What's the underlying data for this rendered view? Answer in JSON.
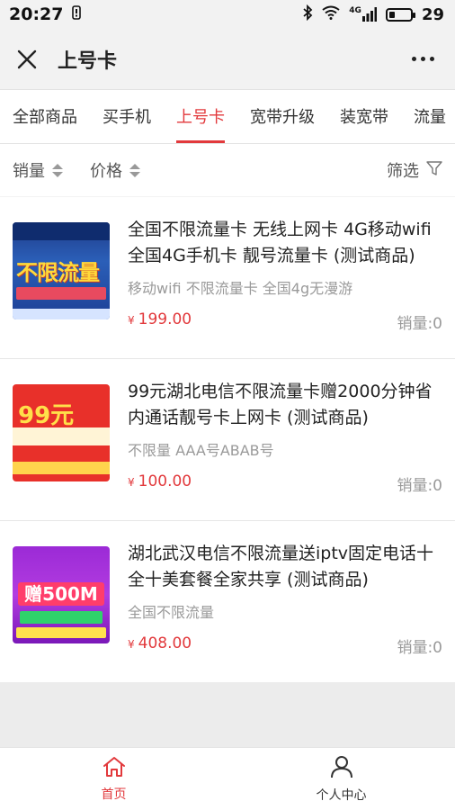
{
  "status": {
    "time": "20:27",
    "network": "4G",
    "battery": "29",
    "battery_level": 0.29
  },
  "titlebar": {
    "title": "上号卡"
  },
  "tabs": [
    {
      "label": "全部商品",
      "active": false
    },
    {
      "label": "买手机",
      "active": false
    },
    {
      "label": "上号卡",
      "active": true
    },
    {
      "label": "宽带升级",
      "active": false
    },
    {
      "label": "装宽带",
      "active": false
    },
    {
      "label": "流量",
      "active": false
    }
  ],
  "sortbar": {
    "sales": "销量",
    "price": "价格",
    "filter": "筛选"
  },
  "products": [
    {
      "title": "全国不限流量卡 无线上网卡 4G移动wifi 全国4G手机卡 靓号流量卡 (测试商品)",
      "subtitle": "移动wifi 不限流量卡 全国4g无漫游",
      "price": "199.00",
      "currency": "¥",
      "sales": "销量:0",
      "thumb_text": "不限流量"
    },
    {
      "title": "99元湖北电信不限流量卡赠2000分钟省内通话靓号卡上网卡 (测试商品)",
      "subtitle": "不限量 AAA号ABAB号",
      "price": "100.00",
      "currency": "¥",
      "sales": "销量:0",
      "thumb_text": "99元"
    },
    {
      "title": "湖北武汉电信不限流量送iptv固定电话十全十美套餐全家共享 (测试商品)",
      "subtitle": "全国不限流量",
      "price": "408.00",
      "currency": "¥",
      "sales": "销量:0",
      "thumb_text": "赠500M"
    }
  ],
  "bottomnav": {
    "home": "首页",
    "profile": "个人中心"
  },
  "colors": {
    "accent": "#e2393c"
  }
}
